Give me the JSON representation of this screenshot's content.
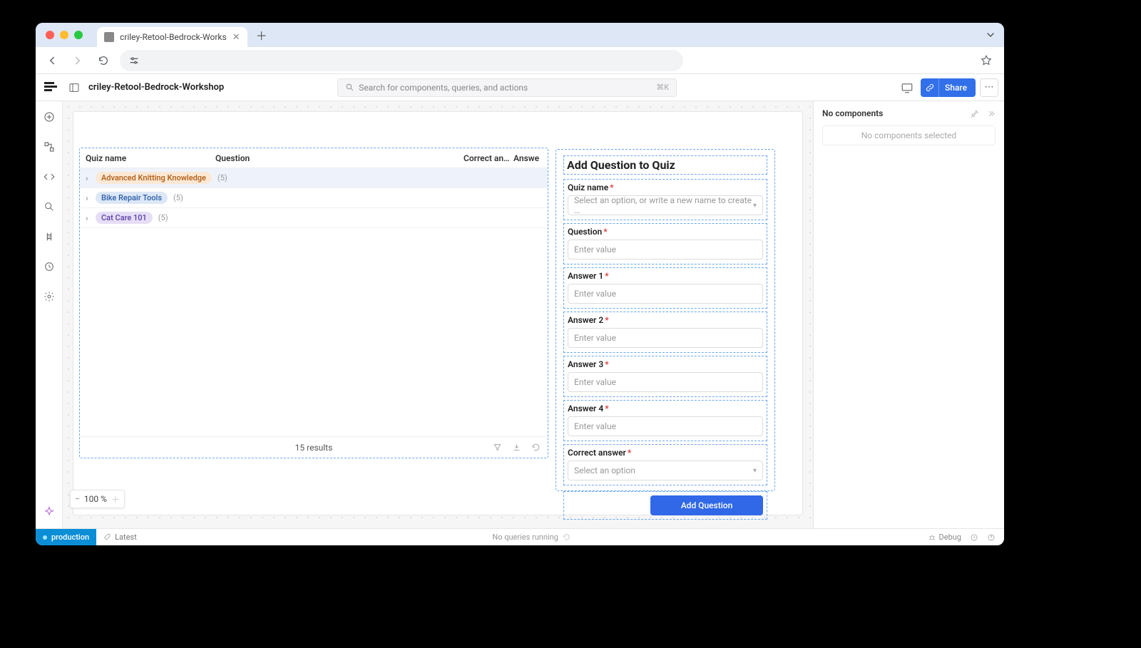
{
  "browser": {
    "tab_title": "criley-Retool-Bedrock-Works"
  },
  "header": {
    "app_title": "criley-Retool-Bedrock-Workshop",
    "search_placeholder": "Search for components, queries, and actions",
    "search_kbd": "⌘K",
    "share_label": "Share"
  },
  "table": {
    "columns": {
      "quiz": "Quiz name",
      "question": "Question",
      "correct": "Correct ans...",
      "answer": "Answe"
    },
    "rows": [
      {
        "name": "Advanced Knitting Knowledge",
        "count": "(5)",
        "tag_class": "tag-orange"
      },
      {
        "name": "Bike Repair Tools",
        "count": "(5)",
        "tag_class": "tag-blue"
      },
      {
        "name": "Cat Care 101",
        "count": "(5)",
        "tag_class": "tag-purple"
      }
    ],
    "footer_text": "15 results"
  },
  "form": {
    "title": "Add Question to Quiz",
    "fields": {
      "quiz_name": {
        "label": "Quiz name",
        "placeholder": "Select an option, or write a new name to create …"
      },
      "question": {
        "label": "Question",
        "placeholder": "Enter value"
      },
      "answer1": {
        "label": "Answer 1",
        "placeholder": "Enter value"
      },
      "answer2": {
        "label": "Answer 2",
        "placeholder": "Enter value"
      },
      "answer3": {
        "label": "Answer 3",
        "placeholder": "Enter value"
      },
      "answer4": {
        "label": "Answer 4",
        "placeholder": "Enter value"
      },
      "correct": {
        "label": "Correct answer",
        "placeholder": "Select an option"
      }
    },
    "submit_label": "Add Question"
  },
  "right_panel": {
    "title": "No components",
    "empty_text": "No components selected"
  },
  "zoom": {
    "value": "100 %"
  },
  "status": {
    "env": "production",
    "latest": "Latest",
    "center": "No queries running",
    "debug": "Debug"
  }
}
